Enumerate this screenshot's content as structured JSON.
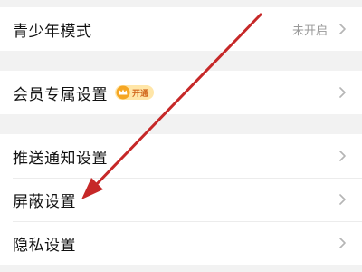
{
  "settings": {
    "teen_mode_label": "青少年模式",
    "teen_mode_status": "未开启",
    "member_settings_label": "会员专属设置",
    "vip_badge_text": "开通",
    "push_notifications_label": "推送通知设置",
    "block_settings_label": "屏蔽设置",
    "privacy_settings_label": "隐私设置"
  },
  "icons": {
    "chevron": "chevron-right-icon",
    "vip": "crown-icon"
  },
  "colors": {
    "annotation_arrow": "#c62828",
    "vip_badge_bg": "#ffe6a8",
    "vip_badge_text": "#d2691e"
  }
}
